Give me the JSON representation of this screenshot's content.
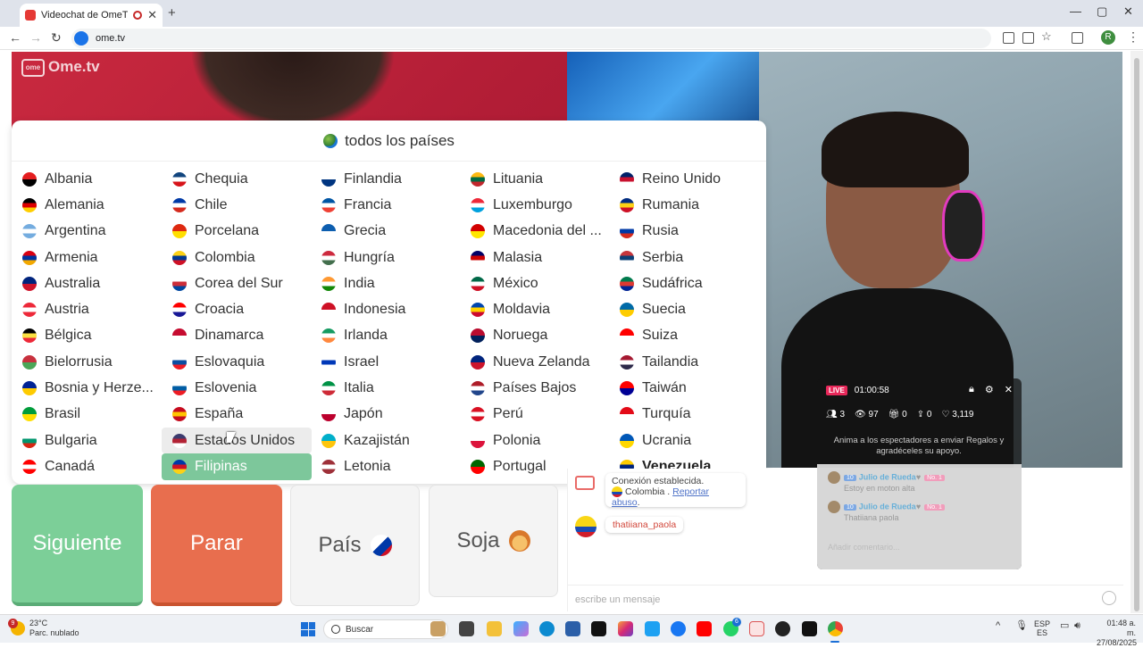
{
  "browser": {
    "tab_title": "Videochat de OmeTV: una",
    "tab_close": "✕",
    "new_tab": "+",
    "url": "ome.tv",
    "profile_initial": "R",
    "window_controls": [
      "—",
      "▢",
      "✕"
    ],
    "nav_icons": [
      "back-icon",
      "forward-icon",
      "reload-icon"
    ]
  },
  "page": {
    "logo": "Ome.tv",
    "dropdown": {
      "header": "todos los países",
      "columns": [
        [
          {
            "name": "Albania",
            "colors": [
              "#e41e20",
              "#000000"
            ]
          },
          {
            "name": "Alemania",
            "colors": [
              "#000000",
              "#dd0000",
              "#ffce00"
            ]
          },
          {
            "name": "Argentina",
            "colors": [
              "#74acdf",
              "#ffffff",
              "#74acdf"
            ]
          },
          {
            "name": "Armenia",
            "colors": [
              "#d90012",
              "#0033a0",
              "#f2a800"
            ]
          },
          {
            "name": "Australia",
            "colors": [
              "#00247d",
              "#cf142b"
            ]
          },
          {
            "name": "Austria",
            "colors": [
              "#ed2939",
              "#ffffff",
              "#ed2939"
            ]
          },
          {
            "name": "Bélgica",
            "colors": [
              "#000000",
              "#fae042",
              "#ed2939"
            ]
          },
          {
            "name": "Bielorrusia",
            "colors": [
              "#c8313e",
              "#4aa657"
            ]
          },
          {
            "name": "Bosnia y Herze...",
            "colors": [
              "#002395",
              "#fecb00"
            ]
          },
          {
            "name": "Brasil",
            "colors": [
              "#009c3b",
              "#ffdf00"
            ]
          },
          {
            "name": "Bulgaria",
            "colors": [
              "#ffffff",
              "#00966e",
              "#d62612"
            ]
          },
          {
            "name": "Canadá",
            "colors": [
              "#ff0000",
              "#ffffff",
              "#ff0000"
            ]
          }
        ],
        [
          {
            "name": "Chequia",
            "colors": [
              "#11457e",
              "#ffffff",
              "#d7141a"
            ]
          },
          {
            "name": "Chile",
            "colors": [
              "#0039a6",
              "#ffffff",
              "#d52b1e"
            ]
          },
          {
            "name": "Porcelana",
            "colors": [
              "#de2910",
              "#ffde00"
            ]
          },
          {
            "name": "Colombia",
            "colors": [
              "#fcd116",
              "#003893",
              "#ce1126"
            ]
          },
          {
            "name": "Corea del Sur",
            "colors": [
              "#ffffff",
              "#cd2e3a",
              "#0047a0"
            ]
          },
          {
            "name": "Croacia",
            "colors": [
              "#ff0000",
              "#ffffff",
              "#171796"
            ]
          },
          {
            "name": "Dinamarca",
            "colors": [
              "#c60c30",
              "#ffffff"
            ]
          },
          {
            "name": "Eslovaquia",
            "colors": [
              "#ffffff",
              "#0b4ea2",
              "#ee1c25"
            ]
          },
          {
            "name": "Eslovenia",
            "colors": [
              "#ffffff",
              "#005da4",
              "#ed1c24"
            ]
          },
          {
            "name": "España",
            "colors": [
              "#c60b1e",
              "#ffc400",
              "#c60b1e"
            ]
          },
          {
            "name": "Estados Unidos",
            "colors": [
              "#3c3b6e",
              "#b22234",
              "#ffffff"
            ]
          },
          {
            "name": "Filipinas",
            "colors": [
              "#0038a8",
              "#ce1126",
              "#fcd116"
            ]
          }
        ],
        [
          {
            "name": "Finlandia",
            "colors": [
              "#ffffff",
              "#003580"
            ]
          },
          {
            "name": "Francia",
            "colors": [
              "#0055a4",
              "#ffffff",
              "#ef4135"
            ]
          },
          {
            "name": "Grecia",
            "colors": [
              "#0d5eaf",
              "#ffffff"
            ]
          },
          {
            "name": "Hungría",
            "colors": [
              "#cd2a3e",
              "#ffffff",
              "#436f4d"
            ]
          },
          {
            "name": "India",
            "colors": [
              "#ff9933",
              "#ffffff",
              "#138808"
            ]
          },
          {
            "name": "Indonesia",
            "colors": [
              "#ce1126",
              "#ffffff"
            ]
          },
          {
            "name": "Irlanda",
            "colors": [
              "#169b62",
              "#ffffff",
              "#ff883e"
            ]
          },
          {
            "name": "Israel",
            "colors": [
              "#ffffff",
              "#0038b8",
              "#ffffff"
            ]
          },
          {
            "name": "Italia",
            "colors": [
              "#009246",
              "#ffffff",
              "#ce2b37"
            ]
          },
          {
            "name": "Japón",
            "colors": [
              "#ffffff",
              "#bc002d"
            ]
          },
          {
            "name": "Kazajistán",
            "colors": [
              "#00afca",
              "#fec50c"
            ]
          },
          {
            "name": "Letonia",
            "colors": [
              "#9e3039",
              "#ffffff",
              "#9e3039"
            ]
          }
        ],
        [
          {
            "name": "Lituania",
            "colors": [
              "#fdb913",
              "#006a44",
              "#c1272d"
            ]
          },
          {
            "name": "Luxemburgo",
            "colors": [
              "#ed2939",
              "#ffffff",
              "#00a1de"
            ]
          },
          {
            "name": "Macedonia del ...",
            "colors": [
              "#d20000",
              "#ffe600"
            ]
          },
          {
            "name": "Malasia",
            "colors": [
              "#010066",
              "#cc0001",
              "#ffffff"
            ]
          },
          {
            "name": "México",
            "colors": [
              "#006847",
              "#ffffff",
              "#ce1126"
            ]
          },
          {
            "name": "Moldavia",
            "colors": [
              "#0046ae",
              "#ffd200",
              "#cc092f"
            ]
          },
          {
            "name": "Noruega",
            "colors": [
              "#ba0c2f",
              "#00205b"
            ]
          },
          {
            "name": "Nueva Zelanda",
            "colors": [
              "#00247d",
              "#cc142b"
            ]
          },
          {
            "name": "Países Bajos",
            "colors": [
              "#ae1c28",
              "#ffffff",
              "#21468b"
            ]
          },
          {
            "name": "Perú",
            "colors": [
              "#d91023",
              "#ffffff",
              "#d91023"
            ]
          },
          {
            "name": "Polonia",
            "colors": [
              "#ffffff",
              "#dc143c"
            ]
          },
          {
            "name": "Portugal",
            "colors": [
              "#006600",
              "#ff0000"
            ]
          }
        ],
        [
          {
            "name": "Reino Unido",
            "colors": [
              "#012169",
              "#c8102e",
              "#ffffff"
            ]
          },
          {
            "name": "Rumania",
            "colors": [
              "#002b7f",
              "#fcd116",
              "#ce1126"
            ]
          },
          {
            "name": "Rusia",
            "colors": [
              "#ffffff",
              "#0039a6",
              "#d52b1e"
            ]
          },
          {
            "name": "Serbia",
            "colors": [
              "#c6363c",
              "#0c4076",
              "#ffffff"
            ]
          },
          {
            "name": "Sudáfrica",
            "colors": [
              "#007a4d",
              "#de3831",
              "#002395"
            ]
          },
          {
            "name": "Suecia",
            "colors": [
              "#006aa7",
              "#fecc00"
            ]
          },
          {
            "name": "Suiza",
            "colors": [
              "#ff0000",
              "#ffffff"
            ]
          },
          {
            "name": "Tailandia",
            "colors": [
              "#a51931",
              "#ffffff",
              "#2d2a4a"
            ]
          },
          {
            "name": "Taiwán",
            "colors": [
              "#fe0000",
              "#000095"
            ]
          },
          {
            "name": "Turquía",
            "colors": [
              "#e30a17",
              "#ffffff"
            ]
          },
          {
            "name": "Ucrania",
            "colors": [
              "#0057b7",
              "#ffd700"
            ]
          },
          {
            "name": "Venezuela",
            "colors": [
              "#ffcc00",
              "#00247d",
              "#cf142b"
            ]
          }
        ]
      ],
      "hovered": "Estados Unidos",
      "selected": "Filipinas",
      "bold": "Venezuela"
    },
    "buttons": {
      "next": "Siguiente",
      "stop": "Parar",
      "country": "País",
      "gender": "Soja"
    },
    "chat": {
      "system_line1": "Conexión establecida.",
      "system_country": "Colombia",
      "system_sep": " . ",
      "report_link": "Reportar abuso",
      "report_suffix": ".",
      "partner_name": "thatiiana_paola",
      "input_placeholder": "escribe un mensaje"
    },
    "live": {
      "badge": "LIVE",
      "timer": "01:00:58",
      "stats": {
        "viewers": "3",
        "views": "97",
        "gifts": "0",
        "shares": "0",
        "likes": "3,119"
      },
      "prompt": "Anima a los espectadores a enviar Regalos y agradéceles su apoyo.",
      "messages": [
        {
          "level": "10",
          "user": "Julio de Rueda",
          "rank": "No. 1",
          "text": "Estoy en moton alta"
        },
        {
          "level": "10",
          "user": "Julio de Rueda",
          "rank": "No. 1",
          "text": "Thatiiana paola"
        }
      ],
      "input_placeholder": "Añadir comentario..."
    }
  },
  "taskbar": {
    "weather_temp": "23°C",
    "weather_desc": "Parc. nublado",
    "weather_badge": "9",
    "search_placeholder": "Buscar",
    "lang_top": "ESP",
    "lang_bottom": "ES",
    "time": "01:48 a. m.",
    "date": "27/08/2025",
    "whatsapp_badge": "6"
  }
}
